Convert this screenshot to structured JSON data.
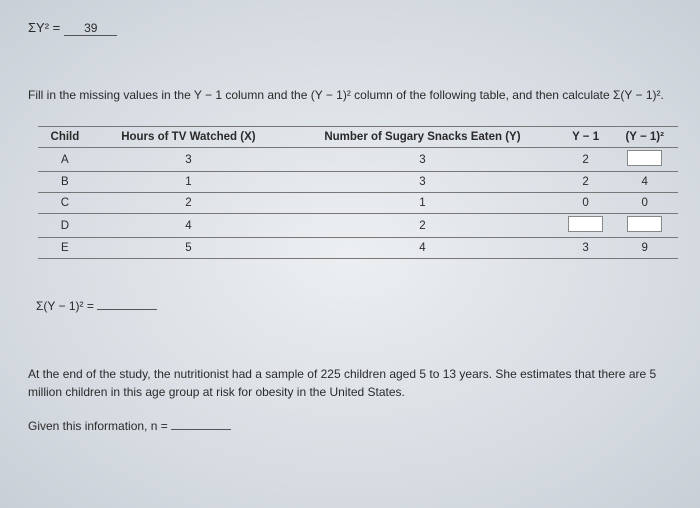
{
  "eq1": {
    "label": "ΣY² =",
    "value": "39"
  },
  "instructions": "Fill in the missing values in the Y − 1 column and the (Y − 1)² column of the following table, and then calculate Σ(Y − 1)².",
  "table": {
    "headers": [
      "Child",
      "Hours of TV Watched (X)",
      "Number of Sugary Snacks Eaten (Y)",
      "Y − 1",
      "(Y − 1)²"
    ],
    "rows": [
      {
        "child": "A",
        "x": "3",
        "y": "3",
        "ym1": "2",
        "ym1sq": ""
      },
      {
        "child": "B",
        "x": "1",
        "y": "3",
        "ym1": "2",
        "ym1sq": "4"
      },
      {
        "child": "C",
        "x": "2",
        "y": "1",
        "ym1": "0",
        "ym1sq": "0"
      },
      {
        "child": "D",
        "x": "4",
        "y": "2",
        "ym1": "",
        "ym1sq": ""
      },
      {
        "child": "E",
        "x": "5",
        "y": "4",
        "ym1": "3",
        "ym1sq": "9"
      }
    ]
  },
  "sum_label": "Σ(Y − 1)² =",
  "para2": "At the end of the study, the nutritionist had a sample of 225 children aged 5 to 13 years. She estimates that there are 5 million children in this age group at risk for obesity in the United States.",
  "given": "Given this information, n ="
}
